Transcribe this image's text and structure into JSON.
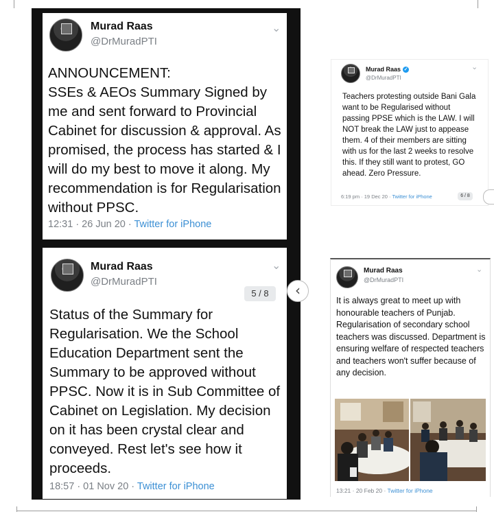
{
  "tweets": [
    {
      "name": "Murad Raas",
      "handle": "@DrMuradPTI",
      "text": "ANNOUNCEMENT:\nSSEs & AEOs Summary Signed by me and sent forward to Provincial Cabinet for discussion & approval. As promised, the process has started & I will do my best to move it along. My recommendation is for Regularisation without PPSC.",
      "timestamp": "12:31 · 26 Jun 20 · ",
      "source": "Twitter for iPhone"
    },
    {
      "name": "Murad Raas",
      "handle": "@DrMuradPTI",
      "page_badge": "5 / 8",
      "text": "Status of the Summary for Regularisation. We the School Education Department sent the Summary to be approved without PPSC. Now it is in Sub Committee of Cabinet on Legislation. My decision on it has been crystal clear and conveyed. Rest let's see how it proceeds.",
      "timestamp": "18:57 · 01 Nov 20 · ",
      "source": "Twitter for iPhone"
    },
    {
      "name": "Murad Raas",
      "handle": "@DrMuradPTI",
      "verified": "✓",
      "page_badge": "6 / 8",
      "text": "Teachers protesting outside Bani Gala want to be Regularised without passing PPSE which is the LAW. I will NOT break the LAW just to appease them. 4 of their members are sitting with us for the last 2 weeks to resolve this. If they still want to protest, GO ahead. Zero Pressure.",
      "timestamp": "6:19 pm · 19 Dec 20 · ",
      "source": "Twitter for iPhone"
    },
    {
      "name": "Murad Raas",
      "handle": "@DrMuradPTI",
      "text": "It is always great to meet up with honourable teachers of Punjab. Regularisation of secondary school teachers was discussed. Department is ensuring welfare of respected teachers and teachers won't suffer because of any decision.",
      "timestamp": "13:21 · 20 Feb 20 · ",
      "source": "Twitter for iPhone"
    }
  ],
  "icons": {
    "chevron": "⌄",
    "nav_prev": "‹"
  },
  "colors": {
    "link": "#3b8fd4",
    "handle": "#7a7f85",
    "dark_panel": "#111111"
  }
}
